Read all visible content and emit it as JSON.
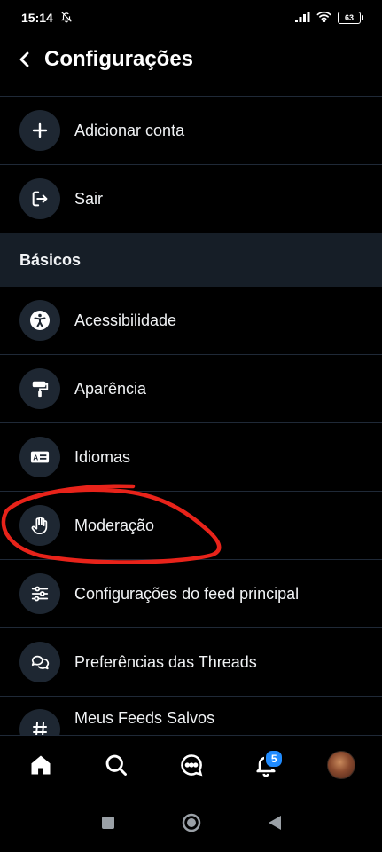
{
  "status_bar": {
    "time": "15:14",
    "battery": "63"
  },
  "header": {
    "title": "Configurações"
  },
  "account_items": [
    {
      "label": "Adicionar conta",
      "icon": "plus-icon"
    },
    {
      "label": "Sair",
      "icon": "logout-icon"
    }
  ],
  "section": {
    "title": "Básicos"
  },
  "basic_items": [
    {
      "label": "Acessibilidade",
      "icon": "accessibility-icon"
    },
    {
      "label": "Aparência",
      "icon": "paint-roller-icon"
    },
    {
      "label": "Idiomas",
      "icon": "language-icon"
    },
    {
      "label": "Moderação",
      "icon": "hand-icon"
    },
    {
      "label": "Configurações do feed principal",
      "icon": "sliders-icon"
    },
    {
      "label": "Preferências das Threads",
      "icon": "chat-bubbles-icon"
    },
    {
      "label": "Meus Feeds Salvos",
      "icon": "hashtag-icon"
    }
  ],
  "tab_bar": {
    "notification_count": "5"
  },
  "annotation_color": "#e8231a"
}
